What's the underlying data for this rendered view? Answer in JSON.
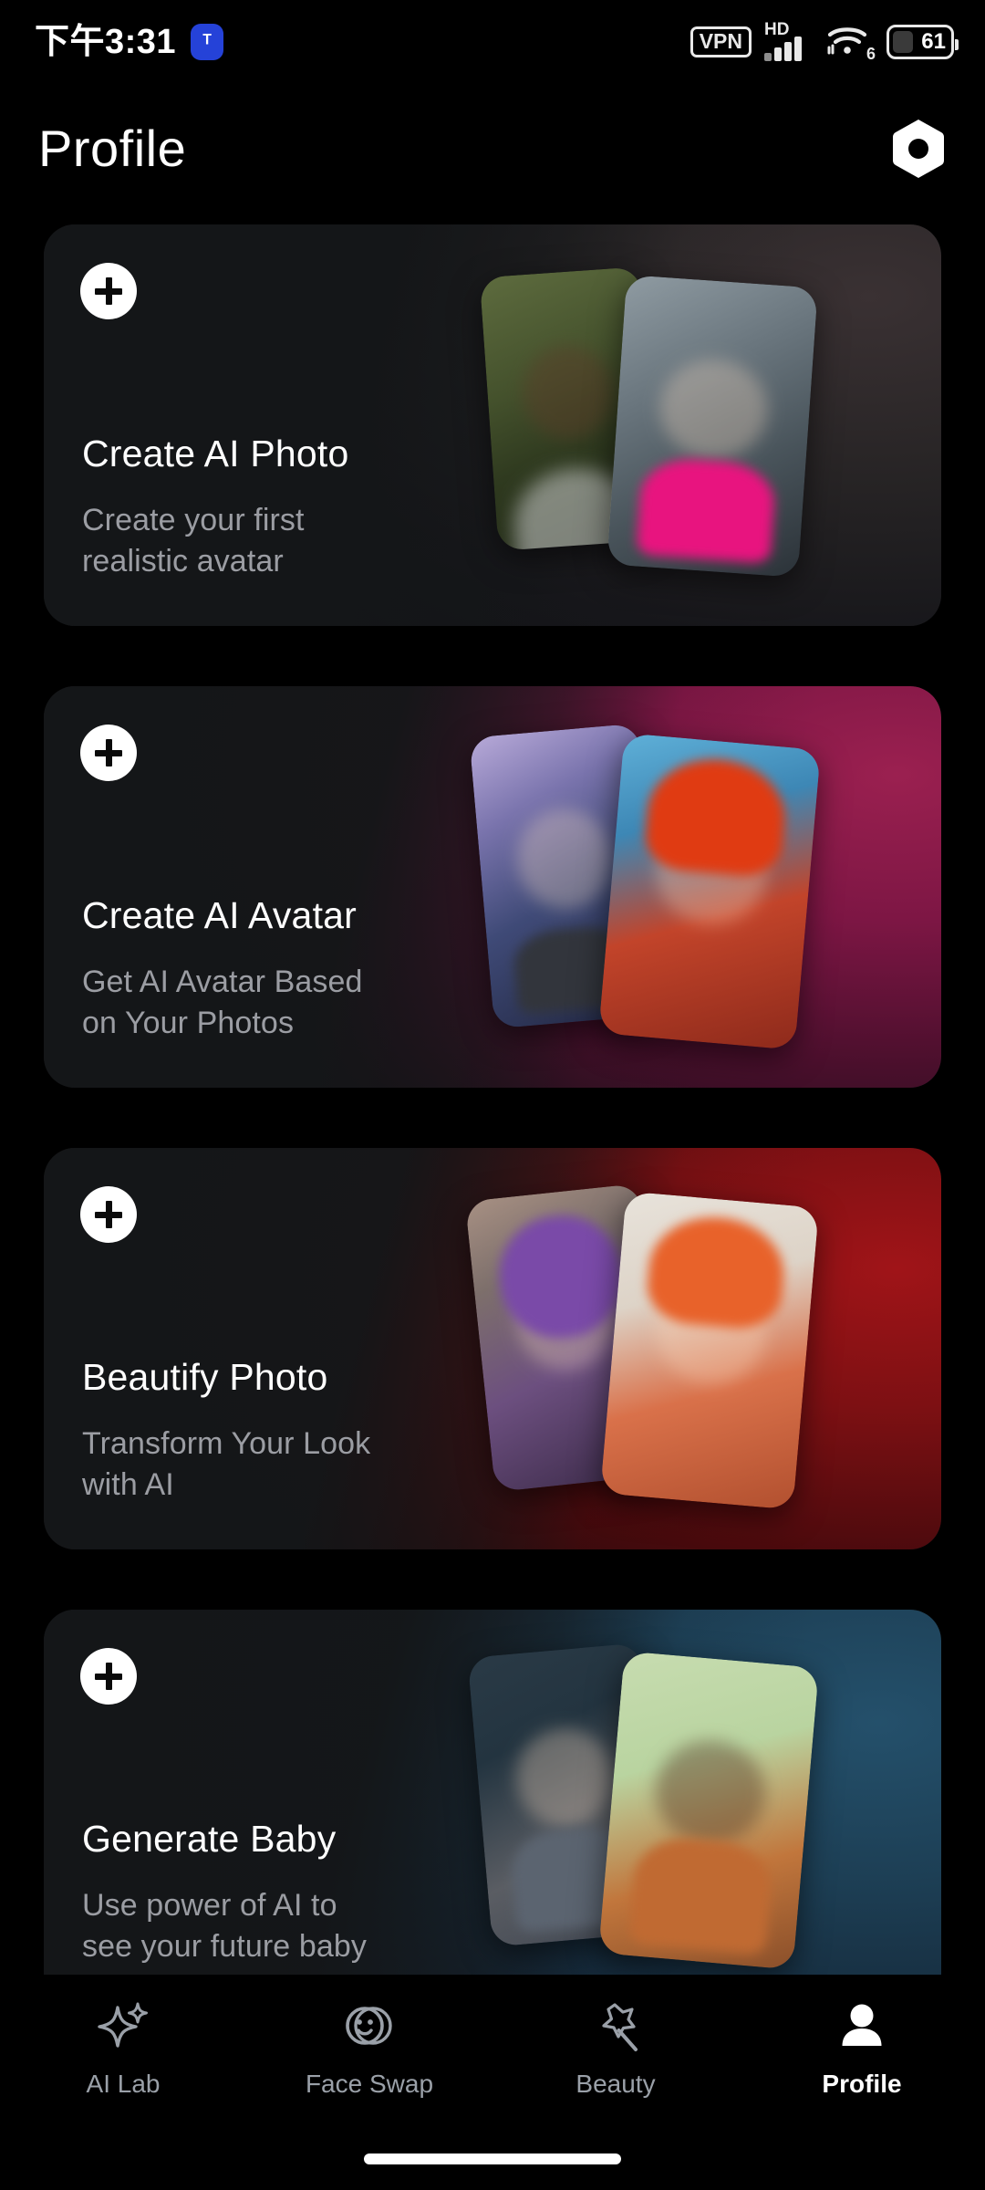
{
  "statusbar": {
    "time": "下午3:31",
    "app_badge_glyph": "ᵀ",
    "app_badge_name": "notification-app-icon",
    "vpn_label": "VPN",
    "network_label": "HD",
    "wifi_generation": "6",
    "battery_percent": "61"
  },
  "header": {
    "title": "Profile",
    "settings_icon": "hexagon-settings-icon"
  },
  "cards": [
    {
      "title": "Create AI Photo",
      "subtitle": "Create your first\nrealistic avatar",
      "subtitle_line1": "Create your first",
      "subtitle_line2": "realistic avatar",
      "add_label": "+",
      "accent": "#3a3133"
    },
    {
      "title": "Create AI Avatar",
      "subtitle": "Get AI Avatar Based\non Your Photos",
      "subtitle_line1": "Get AI Avatar Based",
      "subtitle_line2": "on Your Photos",
      "add_label": "+",
      "accent": "#9b2050"
    },
    {
      "title": "Beautify Photo",
      "subtitle": "Transform Your Look\nwith AI",
      "subtitle_line1": "Transform Your Look",
      "subtitle_line2": "with AI",
      "add_label": "+",
      "accent": "#a01418"
    },
    {
      "title": "Generate Baby",
      "subtitle": "Use power of AI to\nsee your future baby",
      "subtitle_line1": "Use power of AI to",
      "subtitle_line2": "see your future baby",
      "add_label": "+",
      "accent": "#24506b"
    }
  ],
  "bottom_nav": {
    "items": [
      {
        "label": "AI Lab",
        "icon": "sparkle-icon",
        "active": false
      },
      {
        "label": "Face Swap",
        "icon": "face-swap-icon",
        "active": false
      },
      {
        "label": "Beauty",
        "icon": "magic-wand-icon",
        "active": false
      },
      {
        "label": "Profile",
        "icon": "person-icon",
        "active": true
      }
    ],
    "active_color": "#ffffff",
    "inactive_color": "#9aa0a8"
  }
}
